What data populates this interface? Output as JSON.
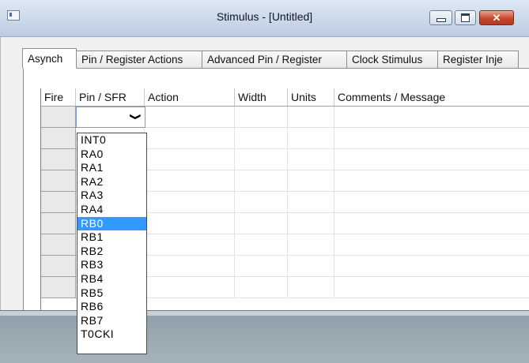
{
  "window": {
    "title": "Stimulus - [Untitled]",
    "close_glyph": "✕"
  },
  "tabs": [
    {
      "label": "Asynch",
      "active": true
    },
    {
      "label": "Pin / Register Actions",
      "active": false
    },
    {
      "label": "Advanced Pin / Register",
      "active": false
    },
    {
      "label": "Clock Stimulus",
      "active": false
    },
    {
      "label": "Register Inje",
      "active": false
    }
  ],
  "grid": {
    "columns": [
      "Fire",
      "Pin / SFR",
      "Action",
      "Width",
      "Units",
      "Comments / Message"
    ],
    "rows": [
      {
        "fire": "",
        "pin_sfr": "",
        "action": "",
        "width": "",
        "units": "",
        "comments": ""
      },
      {
        "fire": "",
        "pin_sfr": "",
        "action": "",
        "width": "",
        "units": "",
        "comments": ""
      },
      {
        "fire": "",
        "pin_sfr": "",
        "action": "",
        "width": "",
        "units": "",
        "comments": ""
      },
      {
        "fire": "",
        "pin_sfr": "",
        "action": "",
        "width": "",
        "units": "",
        "comments": ""
      },
      {
        "fire": "",
        "pin_sfr": "",
        "action": "",
        "width": "",
        "units": "",
        "comments": ""
      },
      {
        "fire": "",
        "pin_sfr": "",
        "action": "",
        "width": "",
        "units": "",
        "comments": ""
      },
      {
        "fire": "",
        "pin_sfr": "",
        "action": "",
        "width": "",
        "units": "",
        "comments": ""
      },
      {
        "fire": "",
        "pin_sfr": "",
        "action": "",
        "width": "",
        "units": "",
        "comments": ""
      },
      {
        "fire": "",
        "pin_sfr": "",
        "action": "",
        "width": "",
        "units": "",
        "comments": ""
      }
    ]
  },
  "combo": {
    "value": "",
    "arrow_glyph": "❯"
  },
  "dropdown": {
    "options": [
      "INT0",
      "RA0",
      "RA1",
      "RA2",
      "RA3",
      "RA4",
      "RB0",
      "RB1",
      "RB2",
      "RB3",
      "RB4",
      "RB5",
      "RB6",
      "RB7",
      "T0CKI"
    ],
    "highlighted": "RB0"
  },
  "colors": {
    "selection": "#3399ff",
    "title_bar": "#c9d7e8",
    "close_button": "#c8452c"
  }
}
